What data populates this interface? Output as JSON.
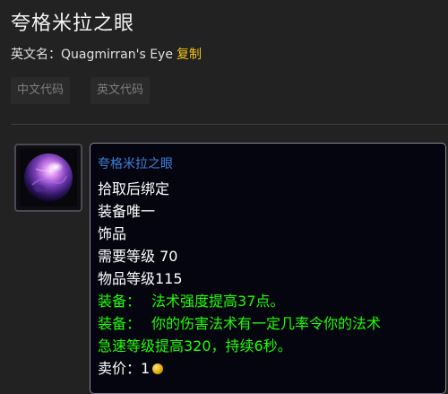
{
  "page": {
    "title": "夸格米拉之眼",
    "english_name_label": "英文名：",
    "english_name": "Quagmirran's Eye",
    "copy_label": "复制"
  },
  "code_buttons": [
    {
      "label": "中文代码"
    },
    {
      "label": "英文代码"
    }
  ],
  "item": {
    "icon": "purple-orb-icon",
    "name": "夸格米拉之眼",
    "name_color": "#3c80d8",
    "lines": [
      "拾取后绑定",
      "装备唯一",
      "饰品",
      "需要等级 70",
      "物品等级115"
    ],
    "equip_effects": [
      {
        "prefix": "装备：",
        "text": "法术强度提高37点。"
      },
      {
        "prefix": "装备：",
        "text": "你的伤害法术有一定几率令你的法术",
        "continuation": "急速等级提高320，持续6秒。"
      }
    ],
    "effect_color": "#1eff00",
    "sell_label": "卖价：",
    "sell_value": "1",
    "sell_currency_icon": "gold-coin-icon"
  }
}
